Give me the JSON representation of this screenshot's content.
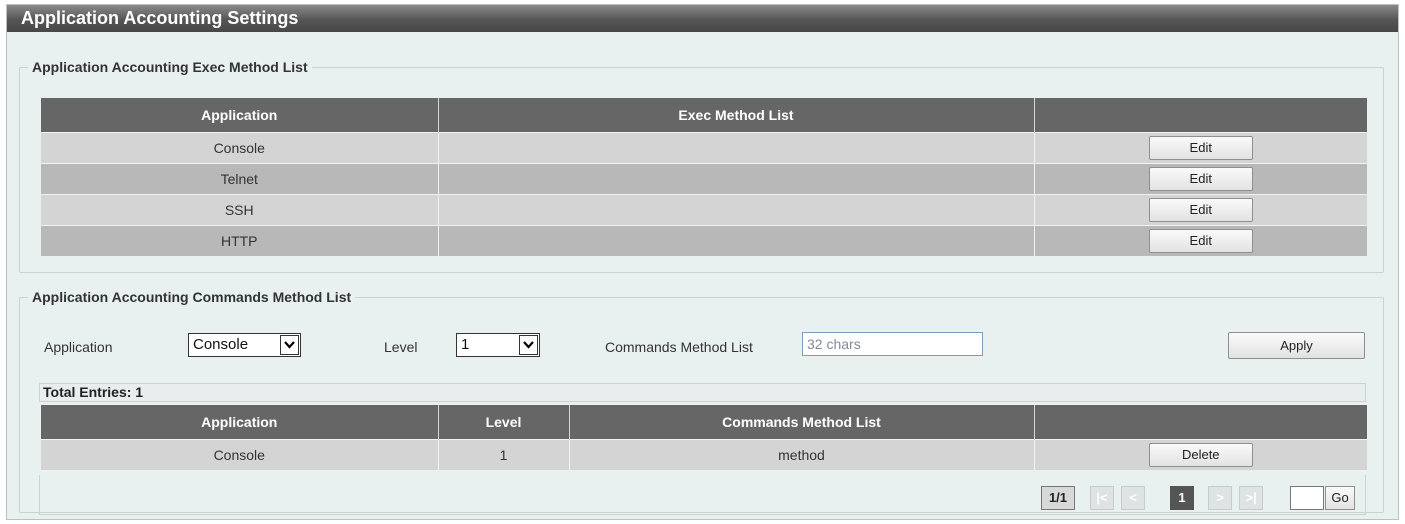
{
  "title": "Application Accounting Settings",
  "exec_section": {
    "legend": "Application Accounting Exec Method List",
    "headers": [
      "Application",
      "Exec Method List",
      ""
    ],
    "rows": [
      {
        "application": "Console",
        "method_list": "",
        "action": "Edit"
      },
      {
        "application": "Telnet",
        "method_list": "",
        "action": "Edit"
      },
      {
        "application": "SSH",
        "method_list": "",
        "action": "Edit"
      },
      {
        "application": "HTTP",
        "method_list": "",
        "action": "Edit"
      }
    ]
  },
  "commands_section": {
    "legend": "Application Accounting Commands Method List",
    "form": {
      "application_label": "Application",
      "application_value": "Console",
      "level_label": "Level",
      "level_value": "1",
      "method_list_label": "Commands Method List",
      "method_list_placeholder": "32 chars",
      "apply_label": "Apply"
    },
    "total_entries": "Total Entries: 1",
    "headers": [
      "Application",
      "Level",
      "Commands Method List",
      ""
    ],
    "rows": [
      {
        "application": "Console",
        "level": "1",
        "method_list": "method",
        "action": "Delete"
      }
    ],
    "pager": {
      "page_info": "1/1",
      "first": "|<",
      "prev": "<",
      "current": "1",
      "next": ">",
      "last": ">|",
      "go_label": "Go"
    }
  }
}
